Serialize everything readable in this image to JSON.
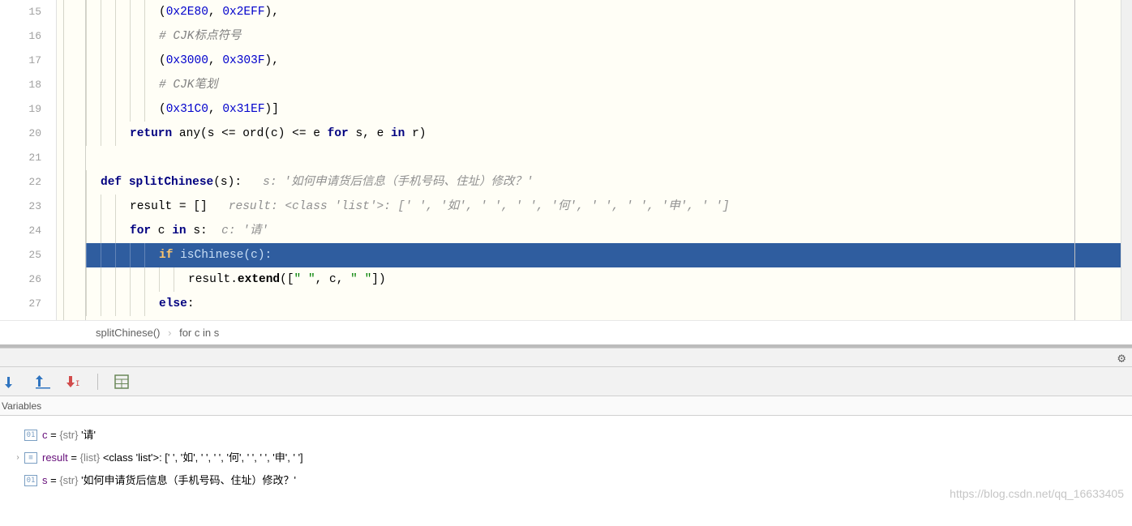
{
  "code": {
    "lines": [
      {
        "n": "15",
        "indent": 5,
        "html": "(<span class='num'>0x2E80</span>, <span class='num'>0x2EFF</span>),"
      },
      {
        "n": "16",
        "indent": 5,
        "html": "<span class='cmt'># CJK标点符号</span>"
      },
      {
        "n": "17",
        "indent": 5,
        "html": "(<span class='num'>0x3000</span>, <span class='num'>0x303F</span>),"
      },
      {
        "n": "18",
        "indent": 5,
        "html": "<span class='cmt'># CJK笔划</span>"
      },
      {
        "n": "19",
        "indent": 5,
        "html": "(<span class='num'>0x31C0</span>, <span class='num'>0x31EF</span>)]"
      },
      {
        "n": "20",
        "indent": 3,
        "html": "<span class='kw'>return</span> any(s &lt;= ord(c) &lt;= e <span class='kw'>for</span> s, e <span class='kw'>in</span> r)"
      },
      {
        "n": "21",
        "indent": 0,
        "html": ""
      },
      {
        "n": "22",
        "indent": 1,
        "html": "<span class='kw'>def</span> <span class='fn'>splitChinese</span>(s):   <span class='hint'>s: '如何申请货后信息（手机号码、住址）修改？'</span>"
      },
      {
        "n": "23",
        "indent": 3,
        "html": "result = []   <span class='hint'>result: &lt;class 'list'&gt;: [' ', '如', ' ', ' ', '何', ' ', ' ', '申', ' ']</span>"
      },
      {
        "n": "24",
        "indent": 3,
        "html": "<span class='kw'>for</span> c <span class='kw'>in</span> s:  <span class='hint'>c: '请'</span>"
      },
      {
        "n": "25",
        "indent": 5,
        "exec": true,
        "html": "<span class='kw'>if</span> isChinese(c):"
      },
      {
        "n": "26",
        "indent": 7,
        "html": "result.<span class='fncall'>extend</span>([<span class='str'>\" \"</span>, c, <span class='str'>\" \"</span>])"
      },
      {
        "n": "27",
        "indent": 5,
        "html": "<span class='kw'>else</span>:"
      }
    ]
  },
  "breadcrumb": {
    "a": "splitChinese()",
    "b": "for c in s"
  },
  "panel": {
    "tab": "Variables"
  },
  "gear_label": "Settings",
  "vars": [
    {
      "expand": "",
      "icon": "01",
      "name": "c",
      "type": "{str}",
      "val": "'请'"
    },
    {
      "expand": "›",
      "icon": "≡",
      "name": "result",
      "type": "{list}",
      "val": "<class 'list'>: [' ', '如', ' ', ' ', '何', ' ', ' ', '申', ' ']"
    },
    {
      "expand": "",
      "icon": "01",
      "name": "s",
      "type": "{str}",
      "val": "'如何申请货后信息（手机号码、住址）修改？'"
    }
  ],
  "watermark": "https://blog.csdn.net/qq_16633405"
}
